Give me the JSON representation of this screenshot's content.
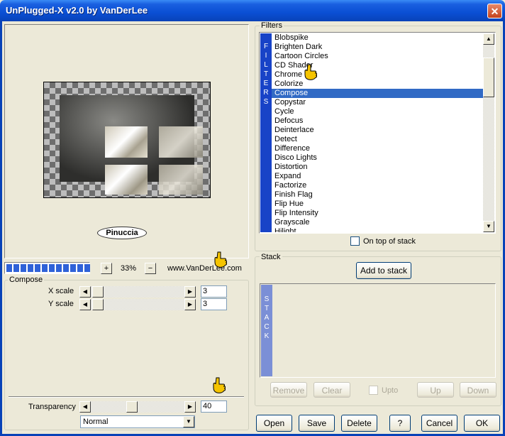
{
  "window": {
    "title": "UnPlugged-X v2.0 by VanDerLee",
    "close_glyph": "✕"
  },
  "preview": {
    "signature": "Pinuccia",
    "zoom": "33%",
    "zoom_minus": "−",
    "zoom_plus": "+",
    "website": "www.VanDerLee.com",
    "progress_segments": 12
  },
  "compose": {
    "group_label": "Compose",
    "params": [
      {
        "label": "X scale",
        "value": "3"
      },
      {
        "label": "Y scale",
        "value": "3"
      }
    ],
    "transparency_label": "Transparency",
    "transparency_value": "40",
    "blend_mode": "Normal"
  },
  "filters": {
    "group_label": "Filters",
    "side_label": [
      "F",
      "I",
      "L",
      "T",
      "E",
      "R",
      "S"
    ],
    "items": [
      "Blobspike",
      "Brighten Dark",
      "Cartoon Circles",
      "CD Shader",
      "Chrome",
      "Colorize",
      "Compose",
      "Copystar",
      "Cycle",
      "Defocus",
      "Deinterlace",
      "Detect",
      "Difference",
      "Disco Lights",
      "Distortion",
      "Expand",
      "Factorize",
      "Finish Flag",
      "Flip Hue",
      "Flip Intensity",
      "Grayscale",
      "Hilight"
    ],
    "selected": "Compose",
    "on_top_label": "On top of stack"
  },
  "stack": {
    "group_label": "Stack",
    "add_button": "Add to stack",
    "side_label": [
      "S",
      "T",
      "A",
      "C",
      "K"
    ],
    "remove": "Remove",
    "clear": "Clear",
    "upto": "Upto",
    "up": "Up",
    "down": "Down"
  },
  "footer": {
    "open": "Open",
    "save": "Save",
    "delete": "Delete",
    "help": "?",
    "cancel": "Cancel",
    "ok": "OK"
  },
  "colors": {
    "title_bar": "#0a4fd4",
    "selection": "#316ac5",
    "vertical_label_bg": "#1843c7",
    "stack_label_bg": "#7b8fd6"
  }
}
